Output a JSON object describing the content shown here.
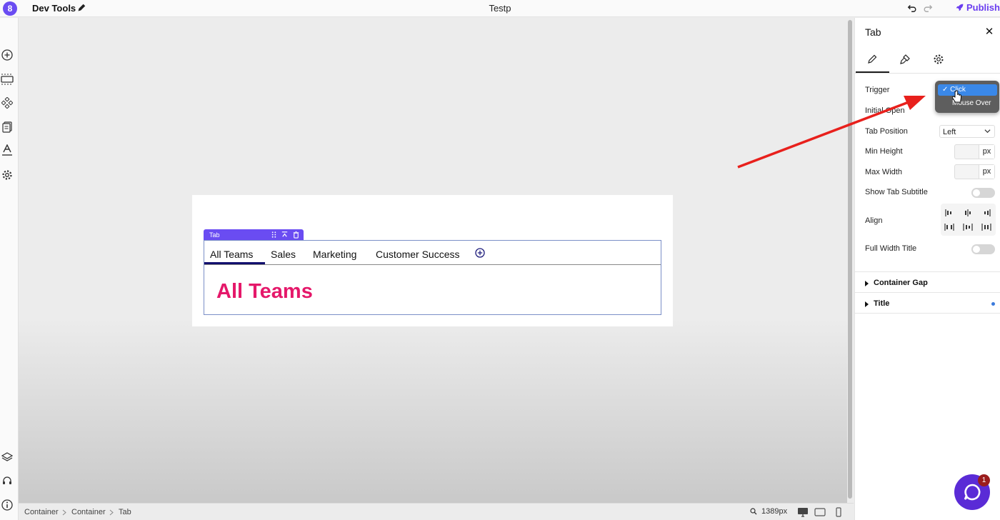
{
  "app": {
    "logo_glyph": "8",
    "title": "Dev Tools",
    "page_name": "Testp",
    "publish_label": "Publish"
  },
  "left_rail": [
    {
      "name": "add-icon"
    },
    {
      "name": "section-icon"
    },
    {
      "name": "components-icon"
    },
    {
      "name": "pages-icon"
    },
    {
      "name": "typography-icon"
    },
    {
      "name": "settings-icon"
    },
    {
      "name": "layers-icon"
    },
    {
      "name": "support-icon"
    },
    {
      "name": "info-icon"
    }
  ],
  "canvas": {
    "tab_chip_label": "Tab",
    "tabs": [
      "All Teams",
      "Sales",
      "Marketing",
      "Customer Success"
    ],
    "active_tab": "All Teams",
    "content_title": "All Teams"
  },
  "statusbar": {
    "breadcrumb": [
      "Container",
      "Container",
      "Tab"
    ],
    "zoom_label": "1389px"
  },
  "panel": {
    "title": "Tab",
    "close_glyph": "✕",
    "rows": {
      "trigger": "Trigger",
      "initial_open": "Initial Open",
      "tab_position": "Tab Position",
      "tab_position_value": "Left",
      "min_height": "Min Height",
      "max_width": "Max Width",
      "unit": "px",
      "show_tab_subtitle": "Show Tab Subtitle",
      "align": "Align",
      "full_width_title": "Full Width Title"
    },
    "sections": [
      "Container Gap",
      "Title"
    ],
    "dropdown": {
      "options": [
        "✓ Click",
        "Mouse Over"
      ],
      "selected": "Click"
    }
  },
  "chat": {
    "badge": "1"
  },
  "colors": {
    "accent": "#6a4cf2",
    "publish": "#6a3df0",
    "tab_title": "#e5186a",
    "arrow": "#e8201c"
  }
}
